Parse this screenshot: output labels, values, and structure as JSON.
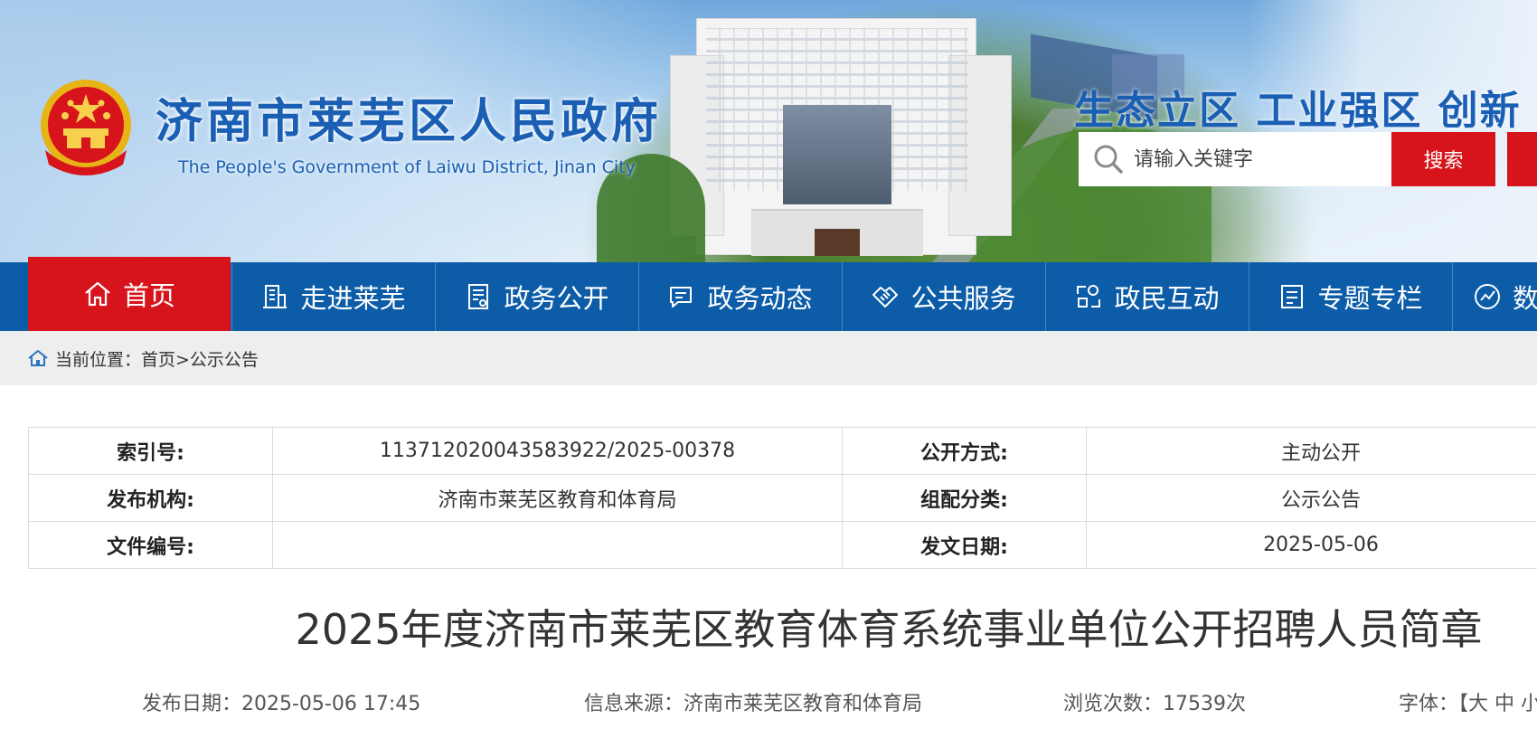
{
  "header": {
    "title": "济南市莱芜区人民政府",
    "subtitle": "The People's Government of Laiwu District, Jinan City",
    "slogan": "生态立区  工业强区  创新",
    "search": {
      "placeholder": "请输入关键字",
      "button_label": "搜索"
    }
  },
  "nav": {
    "items": [
      {
        "label": "首页",
        "icon": "home-icon"
      },
      {
        "label": "走进莱芜",
        "icon": "building-icon"
      },
      {
        "label": "政务公开",
        "icon": "document-icon"
      },
      {
        "label": "政务动态",
        "icon": "chat-icon"
      },
      {
        "label": "公共服务",
        "icon": "handshake-icon"
      },
      {
        "label": "政民互动",
        "icon": "interaction-icon"
      },
      {
        "label": "专题专栏",
        "icon": "topic-icon"
      },
      {
        "label": "数",
        "icon": "chart-icon"
      }
    ]
  },
  "breadcrumb": {
    "text": "当前位置：首页>公示公告"
  },
  "meta": {
    "rows": [
      {
        "label1": "索引号:",
        "value1": "11371202004358392​2/2025-00378",
        "label2": "公开方式:",
        "value2": "主动公开"
      },
      {
        "label1": "发布机构:",
        "value1": "济南市莱芜区教育和体育局",
        "label2": "组配分类:",
        "value2": "公示公告"
      },
      {
        "label1": "文件编号:",
        "value1": "",
        "label2": "发文日期:",
        "value2": "2025-05-06"
      }
    ]
  },
  "article": {
    "title": "2025年度济南市莱芜区教育体育系统事业单位公开招聘人员简章",
    "publish_date": "发布日期：2025-05-06 17:45",
    "source": "信息来源：济南市莱芜区教育和体育局",
    "views": "浏览次数：17539次",
    "font_size": "字体：【大 中 小"
  },
  "colors": {
    "brand_blue": "#0c5ca8",
    "accent_red": "#d7141b",
    "title_blue": "#1a5fb4"
  }
}
